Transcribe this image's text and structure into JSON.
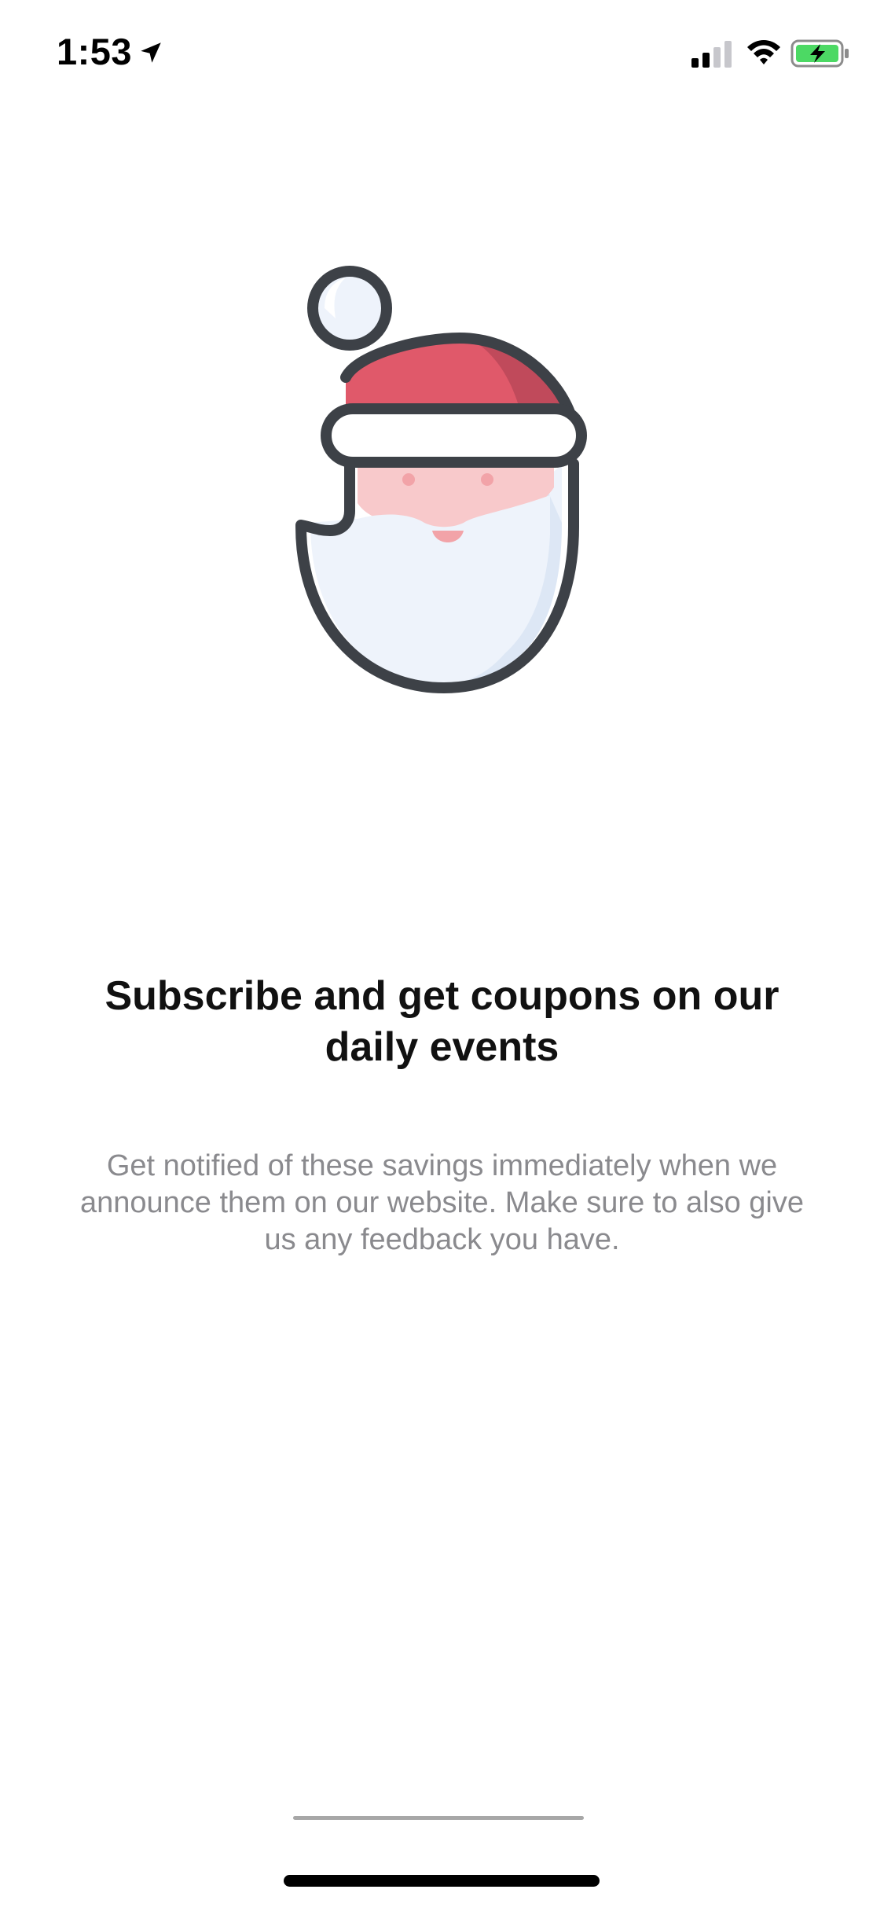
{
  "status_bar": {
    "time": "1:53",
    "location_icon": "location-arrow-icon",
    "signal_icon": "cellular-signal-icon",
    "wifi_icon": "wifi-icon",
    "battery_icon": "battery-charging-icon",
    "battery_color": "#4cd964"
  },
  "hero": {
    "icon": "santa-claus-icon",
    "colors": {
      "outline": "#3d4147",
      "hat": "#e0596a",
      "hat_shade": "#c04a5b",
      "skin": "#f8c9cb",
      "beard": "#eef3fb",
      "mouth": "#f2a3a8"
    }
  },
  "content": {
    "headline": "Subscribe and get coupons on our daily events",
    "description": "Get notified of these savings immediately when we announce them on our website. Make sure to also give us any feedback you have."
  }
}
